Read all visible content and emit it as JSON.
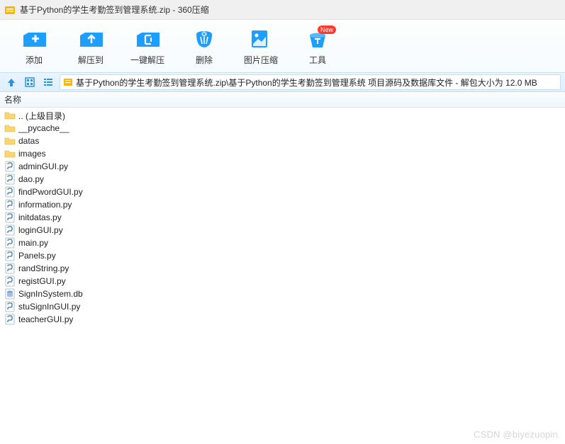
{
  "window": {
    "title": "基于Python的学生考勤签到管理系统.zip - 360压缩"
  },
  "toolbar": {
    "add": "添加",
    "extract_to": "解压到",
    "one_click": "一键解压",
    "delete": "删除",
    "image_compress": "图片压缩",
    "tools": "工具",
    "new_badge": "New"
  },
  "path": "基于Python的学生考勤签到管理系统.zip\\基于Python的学生考勤签到管理系统 项目源码及数据库文件 - 解包大小为 12.0 MB",
  "columns": {
    "name": "名称"
  },
  "files": [
    {
      "name": ".. (上级目录)",
      "type": "folder"
    },
    {
      "name": "__pycache__",
      "type": "folder"
    },
    {
      "name": "datas",
      "type": "folder"
    },
    {
      "name": "images",
      "type": "folder"
    },
    {
      "name": "adminGUI.py",
      "type": "py"
    },
    {
      "name": "dao.py",
      "type": "py"
    },
    {
      "name": "findPwordGUI.py",
      "type": "py"
    },
    {
      "name": "information.py",
      "type": "py"
    },
    {
      "name": "initdatas.py",
      "type": "py"
    },
    {
      "name": "loginGUI.py",
      "type": "py"
    },
    {
      "name": "main.py",
      "type": "py"
    },
    {
      "name": "Panels.py",
      "type": "py"
    },
    {
      "name": "randString.py",
      "type": "py"
    },
    {
      "name": "registGUI.py",
      "type": "py"
    },
    {
      "name": "SignInSystem.db",
      "type": "db"
    },
    {
      "name": "stuSignInGUI.py",
      "type": "py"
    },
    {
      "name": "teacherGUI.py",
      "type": "py"
    }
  ],
  "watermark": "CSDN @biyezuopin"
}
